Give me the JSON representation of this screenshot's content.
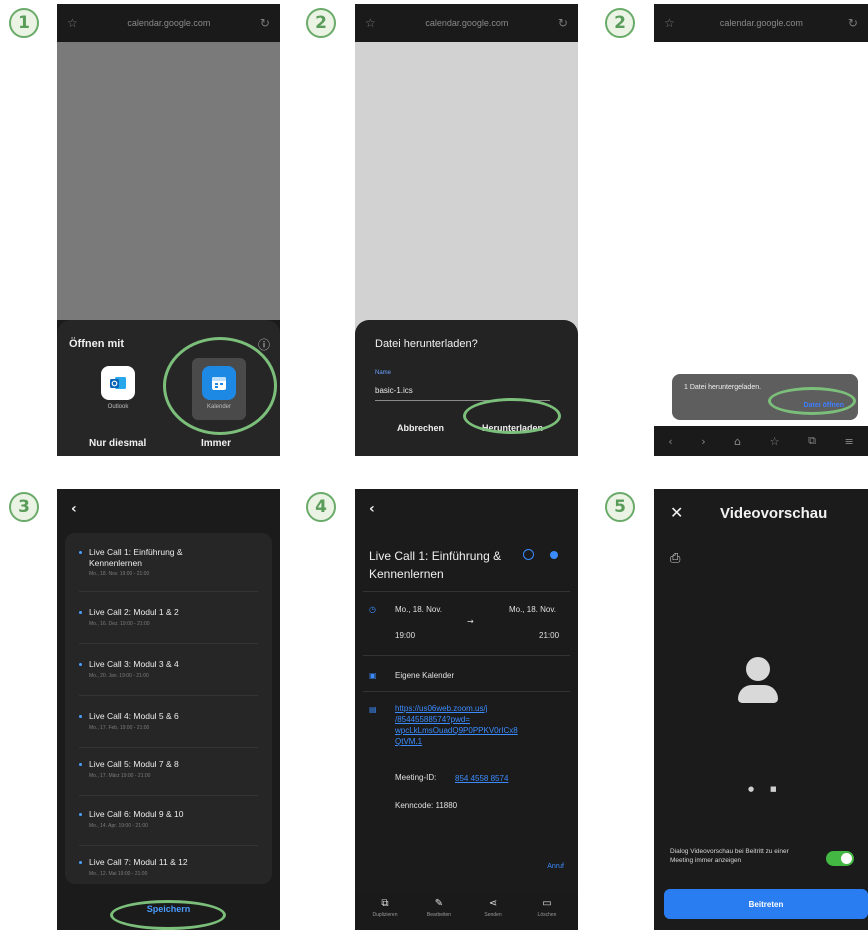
{
  "steps": [
    "1",
    "2",
    "2",
    "3",
    "4",
    "5"
  ],
  "browser": {
    "url": "calendar.google.com"
  },
  "open_with": {
    "title": "Öffnen mit",
    "apps": [
      {
        "label": "Outlook",
        "icon": "outlook-icon"
      },
      {
        "label": "Kalender",
        "icon": "calendar-icon"
      }
    ],
    "once_label": "Nur diesmal",
    "always_label": "Immer"
  },
  "download_dialog": {
    "title": "Datei herunterladen?",
    "name_label": "Name",
    "filename": "basic-1.ics",
    "cancel_label": "Abbrechen",
    "download_label": "Herunterladen"
  },
  "download_toast": {
    "text": "1 Datei heruntergeladen.",
    "action_label": "Datei öffnen"
  },
  "event_list": {
    "items": [
      {
        "title": "Live Call 1: Einführung & Kennenlernen",
        "sub": "Mo., 18. Nov. 19:00 - 21:00"
      },
      {
        "title": "Live Call 2: Modul 1 & 2",
        "sub": "Mo., 16. Dez. 19:00 - 21:00"
      },
      {
        "title": "Live Call 3: Modul 3 & 4",
        "sub": "Mo., 20. Jan. 19:00 - 21:00"
      },
      {
        "title": "Live Call 4: Modul 5 & 6",
        "sub": "Mo., 17. Feb. 19:00 - 21:00"
      },
      {
        "title": "Live Call 5: Modul 7 & 8",
        "sub": "Mo., 17. März 19:00 - 21:00"
      },
      {
        "title": "Live Call 6: Modul 9 & 10",
        "sub": "Mo., 14. Apr. 19:00 - 21:00"
      },
      {
        "title": "Live Call 7: Modul 11 & 12",
        "sub": "Mo., 12. Mai 19:00 - 21:00"
      }
    ],
    "save_label": "Speichern"
  },
  "event_detail": {
    "title": "Live Call 1: Einführung & Kennenlernen",
    "start_date": "Mo., 18. Nov.",
    "start_time": "19:00",
    "end_date": "Mo., 18. Nov.",
    "end_time": "21:00",
    "calendar": "Eigene Kalender",
    "link_lines": [
      "https://us06web.zoom.us/j",
      "/85445588574?pwd=",
      "wpcLkLmsOuadQ9P0PPKV0rICx8",
      "QtVM.1"
    ],
    "meeting_id_label": "Meeting-ID:",
    "meeting_id": "854 4558 8574",
    "passcode": "Kenncode: 11880",
    "call_label": "Anruf",
    "actions": [
      "Duplizieren",
      "Bearbeiten",
      "Senden",
      "Löschen"
    ]
  },
  "video_preview": {
    "title": "Videovorschau",
    "toggle_text": "Dialog Videovorschau bei Beitritt zu einer Meeting immer anzeigen",
    "toggle_on": true,
    "join_label": "Beitreten"
  },
  "colors": {
    "highlight": "#7bbf7b",
    "accent": "#2a7df0",
    "toggle": "#43b843"
  }
}
